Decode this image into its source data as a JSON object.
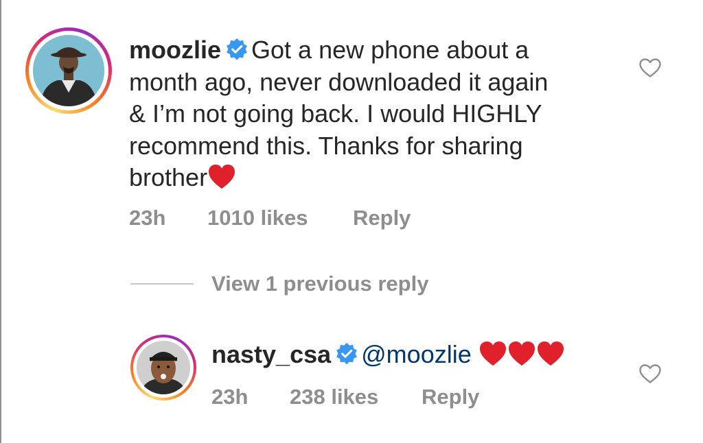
{
  "comments": [
    {
      "username": "moozlie",
      "verified": true,
      "text": "Got a new phone about a month ago, never downloaded it again & I’m not going back. I would HIGHLY recommend this. Thanks for sharing brother",
      "text_lines": [
        "Got a new phone about a",
        "month ago, never downloaded it again",
        "& I’m not going back. I would HIGHLY",
        "recommend this. Thanks for sharing",
        "brother"
      ],
      "emoji": "red-heart",
      "time": "23h",
      "likes": "1010 likes",
      "reply_label": "Reply",
      "avatar_icon": "profile-photo"
    },
    {
      "username": "nasty_csa",
      "verified": true,
      "mention": "@moozlie",
      "emoji": "red-heart x3",
      "time": "23h",
      "likes": "238 likes",
      "reply_label": "Reply",
      "avatar_icon": "profile-photo"
    }
  ],
  "thread": {
    "view_replies_label": "View 1 previous reply"
  },
  "colors": {
    "text": "#262626",
    "secondary": "#8e8e8e",
    "mention": "#00376b",
    "verified_badge": "#3897f0",
    "heart": "#e0202a"
  }
}
